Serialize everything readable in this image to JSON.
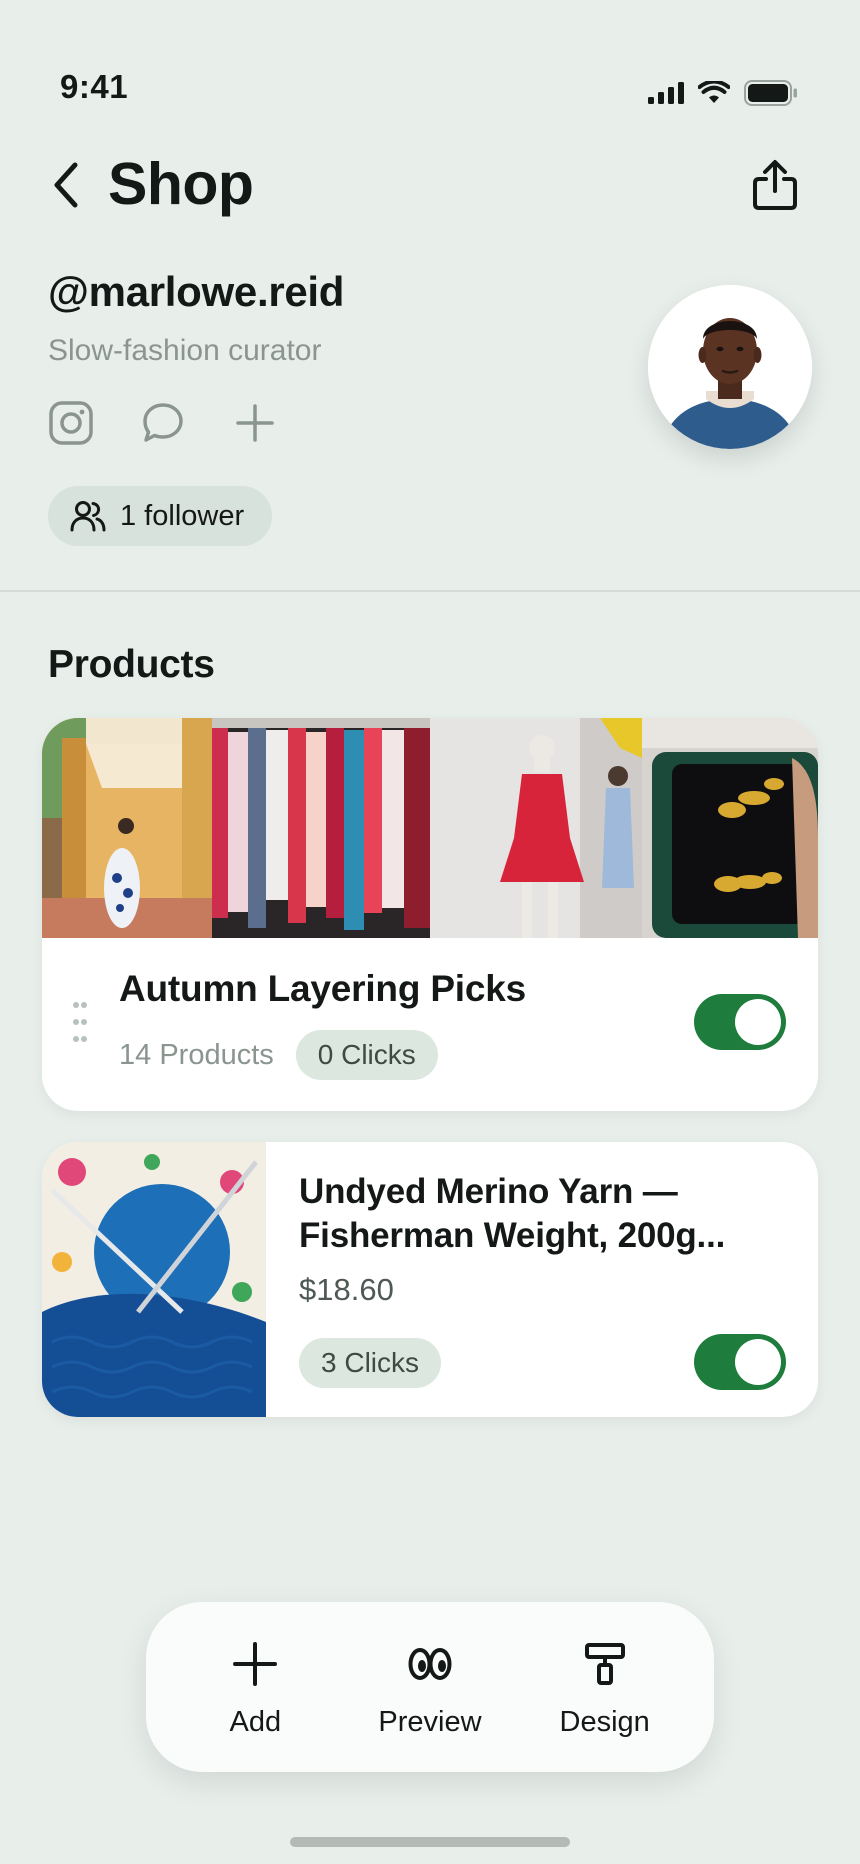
{
  "status_bar": {
    "time": "9:41"
  },
  "header": {
    "title": "Shop"
  },
  "profile": {
    "handle": "@marlowe.reid",
    "bio": "Slow-fashion curator",
    "followers": "1 follower"
  },
  "products_section": {
    "title": "Products"
  },
  "collection": {
    "title": "Autumn Layering Picks",
    "count": "14 Products",
    "clicks": "0 Clicks",
    "enabled": true
  },
  "product": {
    "title": "Undyed Merino Yarn — Fisherman Weight, 200g...",
    "price": "$18.60",
    "clicks": "3 Clicks",
    "enabled": true
  },
  "bottom_nav": {
    "add": "Add",
    "preview": "Preview",
    "design": "Design"
  },
  "colors": {
    "background": "#E8EFEB",
    "accent_green": "#1E7D3C",
    "pill": "#DCE7E0"
  }
}
